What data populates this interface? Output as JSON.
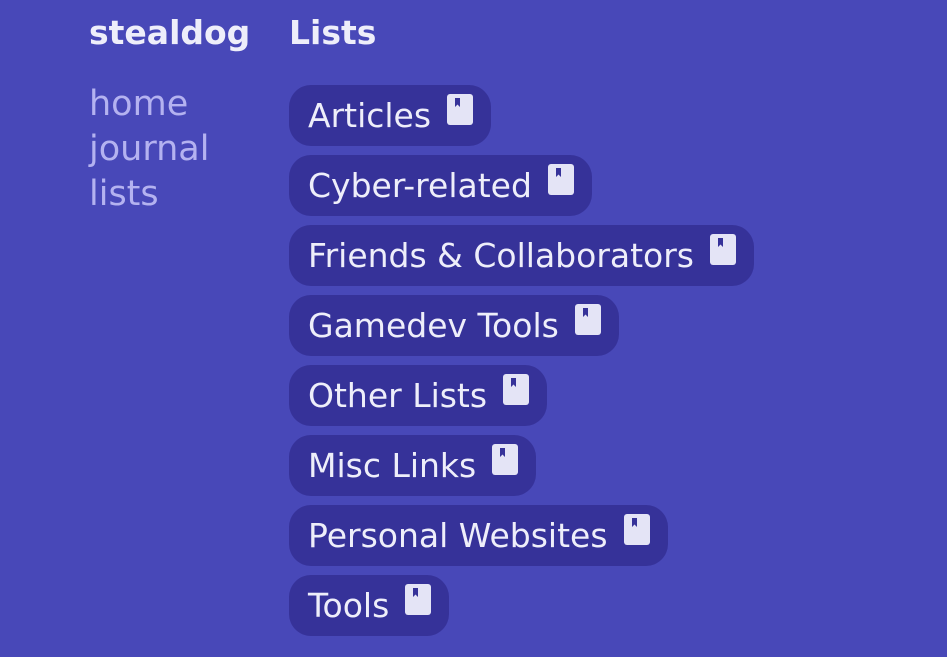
{
  "site": {
    "title": "stealdog"
  },
  "nav": [
    {
      "label": "home"
    },
    {
      "label": "journal"
    },
    {
      "label": "lists"
    }
  ],
  "page": {
    "title": "Lists"
  },
  "lists": [
    {
      "label": "Articles",
      "icon": "bookmark-icon"
    },
    {
      "label": "Cyber-related",
      "icon": "bookmark-icon"
    },
    {
      "label": "Friends & Collaborators",
      "icon": "bookmark-icon"
    },
    {
      "label": "Gamedev Tools",
      "icon": "bookmark-icon"
    },
    {
      "label": "Other Lists",
      "icon": "bookmark-icon"
    },
    {
      "label": "Misc Links",
      "icon": "bookmark-icon"
    },
    {
      "label": "Personal Websites",
      "icon": "bookmark-icon"
    },
    {
      "label": "Tools",
      "icon": "bookmark-icon"
    }
  ],
  "colors": {
    "background": "#4848b8",
    "pill": "#363299",
    "nav_link": "#b4b2f0",
    "text": "#eeeefa"
  }
}
